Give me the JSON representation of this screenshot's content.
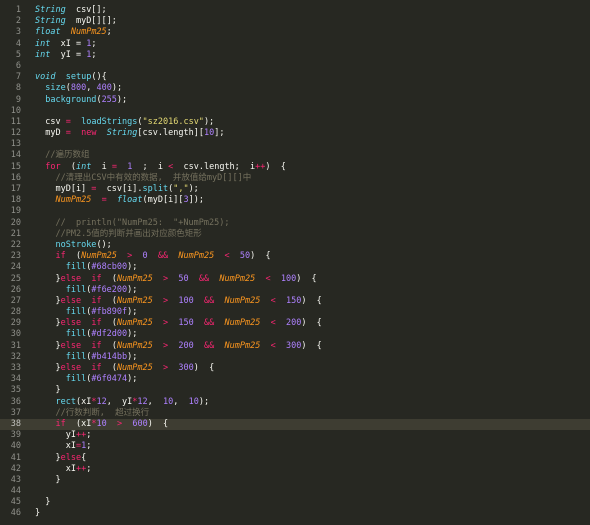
{
  "editor": {
    "active_line": 38,
    "colors": {
      "background": "#272822",
      "keyword": "#f92672",
      "type": "#66d9ef",
      "number": "#ae81ff",
      "string": "#e6db74",
      "comment": "#75715e",
      "parameter": "#fd971f"
    },
    "lines": [
      {
        "n": "1",
        "tokens": [
          [
            "ty",
            "String"
          ],
          [
            "",
            "  csv[];"
          ]
        ]
      },
      {
        "n": "2",
        "tokens": [
          [
            "ty",
            "String"
          ],
          [
            "",
            "  myD[][];"
          ]
        ]
      },
      {
        "n": "3",
        "tokens": [
          [
            "ty",
            "float"
          ],
          [
            "",
            "  "
          ],
          [
            "pl",
            "NumPm25"
          ],
          [
            "",
            ";"
          ]
        ]
      },
      {
        "n": "4",
        "tokens": [
          [
            "ty",
            "int"
          ],
          [
            "",
            "  xI = "
          ],
          [
            "num",
            "1"
          ],
          [
            "",
            ";"
          ]
        ]
      },
      {
        "n": "5",
        "tokens": [
          [
            "ty",
            "int"
          ],
          [
            "",
            "  yI = "
          ],
          [
            "num",
            "1"
          ],
          [
            "",
            ";"
          ]
        ]
      },
      {
        "n": "6",
        "tokens": []
      },
      {
        "n": "7",
        "tokens": [
          [
            "ty",
            "void"
          ],
          [
            "",
            "  "
          ],
          [
            "fn",
            "setup"
          ],
          [
            "",
            "(){"
          ]
        ]
      },
      {
        "n": "8",
        "tokens": [
          [
            "",
            "  "
          ],
          [
            "fn",
            "size"
          ],
          [
            "",
            "("
          ],
          [
            "num",
            "800"
          ],
          [
            "",
            ", "
          ],
          [
            "num",
            "400"
          ],
          [
            "",
            ");"
          ]
        ]
      },
      {
        "n": "9",
        "tokens": [
          [
            "",
            "  "
          ],
          [
            "fn",
            "background"
          ],
          [
            "",
            "("
          ],
          [
            "num",
            "255"
          ],
          [
            "",
            ");"
          ]
        ]
      },
      {
        "n": "10",
        "tokens": []
      },
      {
        "n": "11",
        "tokens": [
          [
            "",
            "  csv "
          ],
          [
            "op",
            "="
          ],
          [
            "",
            "  "
          ],
          [
            "fn",
            "loadStrings"
          ],
          [
            "",
            "("
          ],
          [
            "str",
            "\"sz2016.csv\""
          ],
          [
            "",
            ");"
          ]
        ]
      },
      {
        "n": "12",
        "tokens": [
          [
            "",
            "  myD "
          ],
          [
            "op",
            "="
          ],
          [
            "",
            "  "
          ],
          [
            "kw",
            "new"
          ],
          [
            "",
            "  "
          ],
          [
            "ty",
            "String"
          ],
          [
            "",
            "[csv.length]["
          ],
          [
            "num",
            "10"
          ],
          [
            "",
            "];"
          ]
        ]
      },
      {
        "n": "13",
        "tokens": []
      },
      {
        "n": "14",
        "tokens": [
          [
            "",
            "  "
          ],
          [
            "cm",
            "//遍历数组"
          ]
        ]
      },
      {
        "n": "15",
        "tokens": [
          [
            "",
            "  "
          ],
          [
            "kw",
            "for"
          ],
          [
            "",
            "  ("
          ],
          [
            "ty",
            "int"
          ],
          [
            "",
            "  i "
          ],
          [
            "op",
            "="
          ],
          [
            "",
            "  "
          ],
          [
            "num",
            "1"
          ],
          [
            "",
            "  ;  i "
          ],
          [
            "op",
            "<"
          ],
          [
            "",
            "  csv.length;  i"
          ],
          [
            "op",
            "++"
          ],
          [
            "",
            ")  {"
          ]
        ]
      },
      {
        "n": "16",
        "tokens": [
          [
            "",
            "    "
          ],
          [
            "cm",
            "//清理出CSV中有效的数据,  并放值给myD[][]中"
          ]
        ]
      },
      {
        "n": "17",
        "tokens": [
          [
            "",
            "    myD[i] "
          ],
          [
            "op",
            "="
          ],
          [
            "",
            "  csv[i]."
          ],
          [
            "fn",
            "split"
          ],
          [
            "",
            "("
          ],
          [
            "str",
            "\",\""
          ],
          [
            "",
            ");"
          ]
        ]
      },
      {
        "n": "18",
        "tokens": [
          [
            "",
            "    "
          ],
          [
            "pl",
            "NumPm25"
          ],
          [
            "",
            "  "
          ],
          [
            "op",
            "="
          ],
          [
            "",
            "  "
          ],
          [
            "ty",
            "float"
          ],
          [
            "",
            "(myD[i]["
          ],
          [
            "num",
            "3"
          ],
          [
            "",
            "]);"
          ]
        ]
      },
      {
        "n": "19",
        "tokens": []
      },
      {
        "n": "20",
        "tokens": [
          [
            "",
            "    "
          ],
          [
            "cm",
            "//  println(\"NumPm25:  \"+NumPm25);"
          ]
        ]
      },
      {
        "n": "21",
        "tokens": [
          [
            "",
            "    "
          ],
          [
            "cm",
            "//PM2.5值的判断并画出对应颜色矩形"
          ]
        ]
      },
      {
        "n": "22",
        "tokens": [
          [
            "",
            "    "
          ],
          [
            "fn",
            "noStroke"
          ],
          [
            "",
            "();"
          ]
        ]
      },
      {
        "n": "23",
        "tokens": [
          [
            "",
            "    "
          ],
          [
            "kw",
            "if"
          ],
          [
            "",
            "  ("
          ],
          [
            "pl",
            "NumPm25"
          ],
          [
            "",
            "  "
          ],
          [
            "op",
            ">"
          ],
          [
            "",
            "  "
          ],
          [
            "num",
            "0"
          ],
          [
            "",
            "  "
          ],
          [
            "op",
            "&&"
          ],
          [
            "",
            "  "
          ],
          [
            "pl",
            "NumPm25"
          ],
          [
            "",
            "  "
          ],
          [
            "op",
            "<"
          ],
          [
            "",
            "  "
          ],
          [
            "num",
            "50"
          ],
          [
            "",
            ")  {"
          ]
        ]
      },
      {
        "n": "24",
        "tokens": [
          [
            "",
            "      "
          ],
          [
            "fn",
            "fill"
          ],
          [
            "",
            "("
          ],
          [
            "num",
            "#68cb00"
          ],
          [
            "",
            ");"
          ]
        ]
      },
      {
        "n": "25",
        "tokens": [
          [
            "",
            "    }"
          ],
          [
            "kw",
            "else"
          ],
          [
            "",
            "  "
          ],
          [
            "kw",
            "if"
          ],
          [
            "",
            "  ("
          ],
          [
            "pl",
            "NumPm25"
          ],
          [
            "",
            "  "
          ],
          [
            "op",
            ">"
          ],
          [
            "",
            "  "
          ],
          [
            "num",
            "50"
          ],
          [
            "",
            "  "
          ],
          [
            "op",
            "&&"
          ],
          [
            "",
            "  "
          ],
          [
            "pl",
            "NumPm25"
          ],
          [
            "",
            "  "
          ],
          [
            "op",
            "<"
          ],
          [
            "",
            "  "
          ],
          [
            "num",
            "100"
          ],
          [
            "",
            ")  {"
          ]
        ]
      },
      {
        "n": "26",
        "tokens": [
          [
            "",
            "      "
          ],
          [
            "fn",
            "fill"
          ],
          [
            "",
            "("
          ],
          [
            "num",
            "#f6e200"
          ],
          [
            "",
            ");"
          ]
        ]
      },
      {
        "n": "27",
        "tokens": [
          [
            "",
            "    }"
          ],
          [
            "kw",
            "else"
          ],
          [
            "",
            "  "
          ],
          [
            "kw",
            "if"
          ],
          [
            "",
            "  ("
          ],
          [
            "pl",
            "NumPm25"
          ],
          [
            "",
            "  "
          ],
          [
            "op",
            ">"
          ],
          [
            "",
            "  "
          ],
          [
            "num",
            "100"
          ],
          [
            "",
            "  "
          ],
          [
            "op",
            "&&"
          ],
          [
            "",
            "  "
          ],
          [
            "pl",
            "NumPm25"
          ],
          [
            "",
            "  "
          ],
          [
            "op",
            "<"
          ],
          [
            "",
            "  "
          ],
          [
            "num",
            "150"
          ],
          [
            "",
            ")  {"
          ]
        ]
      },
      {
        "n": "28",
        "tokens": [
          [
            "",
            "      "
          ],
          [
            "fn",
            "fill"
          ],
          [
            "",
            "("
          ],
          [
            "num",
            "#fb890f"
          ],
          [
            "",
            ");"
          ]
        ]
      },
      {
        "n": "29",
        "tokens": [
          [
            "",
            "    }"
          ],
          [
            "kw",
            "else"
          ],
          [
            "",
            "  "
          ],
          [
            "kw",
            "if"
          ],
          [
            "",
            "  ("
          ],
          [
            "pl",
            "NumPm25"
          ],
          [
            "",
            "  "
          ],
          [
            "op",
            ">"
          ],
          [
            "",
            "  "
          ],
          [
            "num",
            "150"
          ],
          [
            "",
            "  "
          ],
          [
            "op",
            "&&"
          ],
          [
            "",
            "  "
          ],
          [
            "pl",
            "NumPm25"
          ],
          [
            "",
            "  "
          ],
          [
            "op",
            "<"
          ],
          [
            "",
            "  "
          ],
          [
            "num",
            "200"
          ],
          [
            "",
            ")  {"
          ]
        ]
      },
      {
        "n": "30",
        "tokens": [
          [
            "",
            "      "
          ],
          [
            "fn",
            "fill"
          ],
          [
            "",
            "("
          ],
          [
            "num",
            "#df2d00"
          ],
          [
            "",
            ");"
          ]
        ]
      },
      {
        "n": "31",
        "tokens": [
          [
            "",
            "    }"
          ],
          [
            "kw",
            "else"
          ],
          [
            "",
            "  "
          ],
          [
            "kw",
            "if"
          ],
          [
            "",
            "  ("
          ],
          [
            "pl",
            "NumPm25"
          ],
          [
            "",
            "  "
          ],
          [
            "op",
            ">"
          ],
          [
            "",
            "  "
          ],
          [
            "num",
            "200"
          ],
          [
            "",
            "  "
          ],
          [
            "op",
            "&&"
          ],
          [
            "",
            "  "
          ],
          [
            "pl",
            "NumPm25"
          ],
          [
            "",
            "  "
          ],
          [
            "op",
            "<"
          ],
          [
            "",
            "  "
          ],
          [
            "num",
            "300"
          ],
          [
            "",
            ")  {"
          ]
        ]
      },
      {
        "n": "32",
        "tokens": [
          [
            "",
            "      "
          ],
          [
            "fn",
            "fill"
          ],
          [
            "",
            "("
          ],
          [
            "num",
            "#b414bb"
          ],
          [
            "",
            ");"
          ]
        ]
      },
      {
        "n": "33",
        "tokens": [
          [
            "",
            "    }"
          ],
          [
            "kw",
            "else"
          ],
          [
            "",
            "  "
          ],
          [
            "kw",
            "if"
          ],
          [
            "",
            "  ("
          ],
          [
            "pl",
            "NumPm25"
          ],
          [
            "",
            "  "
          ],
          [
            "op",
            ">"
          ],
          [
            "",
            "  "
          ],
          [
            "num",
            "300"
          ],
          [
            "",
            ")  {"
          ]
        ]
      },
      {
        "n": "34",
        "tokens": [
          [
            "",
            "      "
          ],
          [
            "fn",
            "fill"
          ],
          [
            "",
            "("
          ],
          [
            "num",
            "#6f0474"
          ],
          [
            "",
            ");"
          ]
        ]
      },
      {
        "n": "35",
        "tokens": [
          [
            "",
            "    }"
          ]
        ]
      },
      {
        "n": "36",
        "tokens": [
          [
            "",
            "    "
          ],
          [
            "fn",
            "rect"
          ],
          [
            "",
            "(xI"
          ],
          [
            "op",
            "*"
          ],
          [
            "num",
            "12"
          ],
          [
            "",
            ",  yI"
          ],
          [
            "op",
            "*"
          ],
          [
            "num",
            "12"
          ],
          [
            "",
            ",  "
          ],
          [
            "num",
            "10"
          ],
          [
            "",
            ",  "
          ],
          [
            "num",
            "10"
          ],
          [
            "",
            ");"
          ]
        ]
      },
      {
        "n": "37",
        "tokens": [
          [
            "",
            "    "
          ],
          [
            "cm",
            "//行数判断,  超过换行"
          ]
        ]
      },
      {
        "n": "38",
        "tokens": [
          [
            "",
            "    "
          ],
          [
            "kw",
            "if"
          ],
          [
            "",
            "  (xI"
          ],
          [
            "op",
            "*"
          ],
          [
            "num",
            "10"
          ],
          [
            "",
            "  "
          ],
          [
            "op",
            ">"
          ],
          [
            "",
            "  "
          ],
          [
            "num",
            "600"
          ],
          [
            "",
            ")  {"
          ]
        ]
      },
      {
        "n": "39",
        "tokens": [
          [
            "",
            "      yI"
          ],
          [
            "op",
            "++"
          ],
          [
            "",
            ";"
          ]
        ]
      },
      {
        "n": "40",
        "tokens": [
          [
            "",
            "      xI"
          ],
          [
            "op",
            "="
          ],
          [
            "num",
            "1"
          ],
          [
            "",
            ";"
          ]
        ]
      },
      {
        "n": "41",
        "tokens": [
          [
            "",
            "    }"
          ],
          [
            "kw",
            "else"
          ],
          [
            "",
            "{"
          ]
        ]
      },
      {
        "n": "42",
        "tokens": [
          [
            "",
            "      xI"
          ],
          [
            "op",
            "++"
          ],
          [
            "",
            ";"
          ]
        ]
      },
      {
        "n": "43",
        "tokens": [
          [
            "",
            "    }"
          ]
        ]
      },
      {
        "n": "44",
        "tokens": []
      },
      {
        "n": "45",
        "tokens": [
          [
            "",
            "  }"
          ]
        ]
      },
      {
        "n": "46",
        "tokens": [
          [
            "",
            "}"
          ]
        ]
      }
    ]
  }
}
